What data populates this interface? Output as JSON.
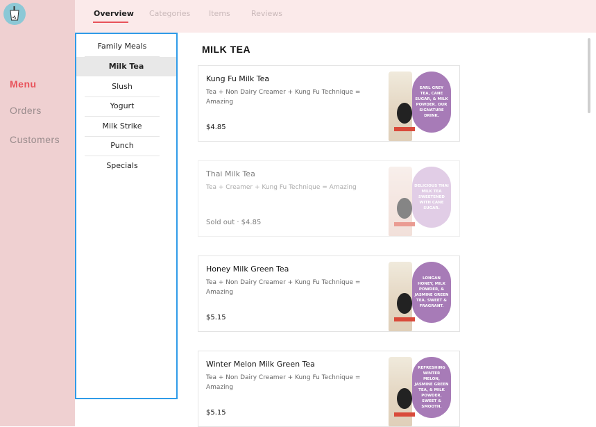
{
  "nav": {
    "items": [
      {
        "label": "Menu",
        "active": true
      },
      {
        "label": "Orders",
        "active": false
      },
      {
        "label": "Customers",
        "active": false
      }
    ]
  },
  "tabs": [
    {
      "label": "Overview",
      "active": true
    },
    {
      "label": "Categories",
      "active": false
    },
    {
      "label": "Items",
      "active": false
    },
    {
      "label": "Reviews",
      "active": false
    }
  ],
  "categories": [
    {
      "label": "Family Meals"
    },
    {
      "label": "Milk Tea",
      "selected": true
    },
    {
      "label": "Slush"
    },
    {
      "label": "Yogurt"
    },
    {
      "label": "Milk Strike"
    },
    {
      "label": "Punch"
    },
    {
      "label": "Specials"
    }
  ],
  "section_title": "MILK TEA",
  "items": [
    {
      "name": "Kung Fu Milk Tea",
      "description": "Tea + Non Dairy Creamer + Kung Fu Technique = Amazing",
      "price": "$4.85",
      "sold_out": false,
      "bubble_text": "EARL GREY TEA, CANE SUGAR, & MILK POWDER. OUR SIGNATURE DRINK."
    },
    {
      "name": "Thai Milk Tea",
      "description": "Tea + Creamer + Kung Fu Technique = Amazing",
      "price": "Sold out · $4.85",
      "sold_out": true,
      "bubble_text": "DELICIOUS THAI MILK TEA SWEETENED WITH CANE SUGAR."
    },
    {
      "name": "Honey Milk Green Tea",
      "description": "Tea + Non Dairy Creamer + Kung Fu Technique = Amazing",
      "price": "$5.15",
      "sold_out": false,
      "bubble_text": "LONGAN HONEY, MILK POWDER, & JASMINE GREEN TEA. SWEET & FRAGRANT."
    },
    {
      "name": "Winter Melon Milk Green Tea",
      "description": "Tea + Non Dairy Creamer + Kung Fu Technique = Amazing",
      "price": "$5.15",
      "sold_out": false,
      "bubble_text": "REFRESHING WINTER MELON, JASMINE GREEN TEA, & MILK POWDER. SWEET & SMOOTH."
    }
  ],
  "colors": {
    "accent": "#e8525a",
    "sidebar_bg": "#efd0d1",
    "topbar_bg": "#fbeaea",
    "focus_border": "#2f9be8",
    "bubble": "#a77bb7"
  },
  "icons": {
    "logo": "boba-cup-icon"
  }
}
